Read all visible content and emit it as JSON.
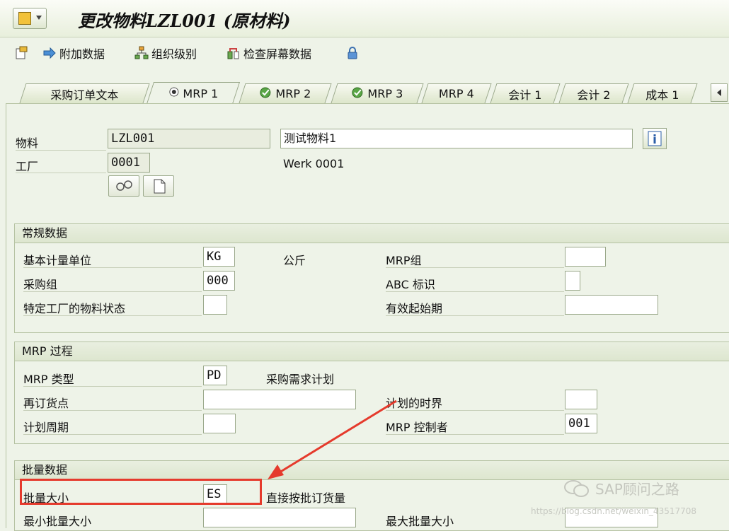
{
  "window": {
    "title": "更改物料LZL001 (原材料)"
  },
  "toolbar": {
    "items": [
      "附加数据",
      "组织级别",
      "检查屏幕数据"
    ]
  },
  "tabs": [
    "采购订单文本",
    "MRP 1",
    "MRP 2",
    "MRP 3",
    "MRP 4",
    "会计 1",
    "会计 2",
    "成本 1"
  ],
  "header": {
    "material_label": "物料",
    "material_value": "LZL001",
    "material_desc": "测试物料1",
    "plant_label": "工厂",
    "plant_value": "0001",
    "plant_desc": "Werk 0001"
  },
  "general": {
    "title": "常规数据",
    "base_uom_label": "基本计量单位",
    "base_uom_value": "KG",
    "base_uom_text": "公斤",
    "purch_group_label": "采购组",
    "purch_group_value": "000",
    "plant_status_label": "特定工厂的物料状态",
    "plant_status_value": "",
    "mrp_group_label": "MRP组",
    "mrp_group_value": "",
    "abc_label": "ABC 标识",
    "abc_value": "",
    "valid_from_label": "有效起始期",
    "valid_from_value": ""
  },
  "mrp_process": {
    "title": "MRP 过程",
    "mrp_type_label": "MRP 类型",
    "mrp_type_value": "PD",
    "mrp_type_text": "采购需求计划",
    "reorder_label": "再订货点",
    "reorder_value": "",
    "period_label": "计划周期",
    "period_value": "",
    "fence_label": "计划的时界",
    "fence_value": "",
    "controller_label": "MRP 控制者",
    "controller_value": "001"
  },
  "lot_size": {
    "title": "批量数据",
    "lot_label": "批量大小",
    "lot_value": "ES",
    "lot_text": "直接按批订货量",
    "min_label": "最小批量大小",
    "min_value": "",
    "max_label": "最大批量大小",
    "max_value": ""
  },
  "watermark": {
    "brand": "SAP顾问之路",
    "url": "https://blog.csdn.net/weixin_43517708"
  },
  "colors": {
    "highlight": "#e53a2c",
    "background": "#eef3e8"
  }
}
